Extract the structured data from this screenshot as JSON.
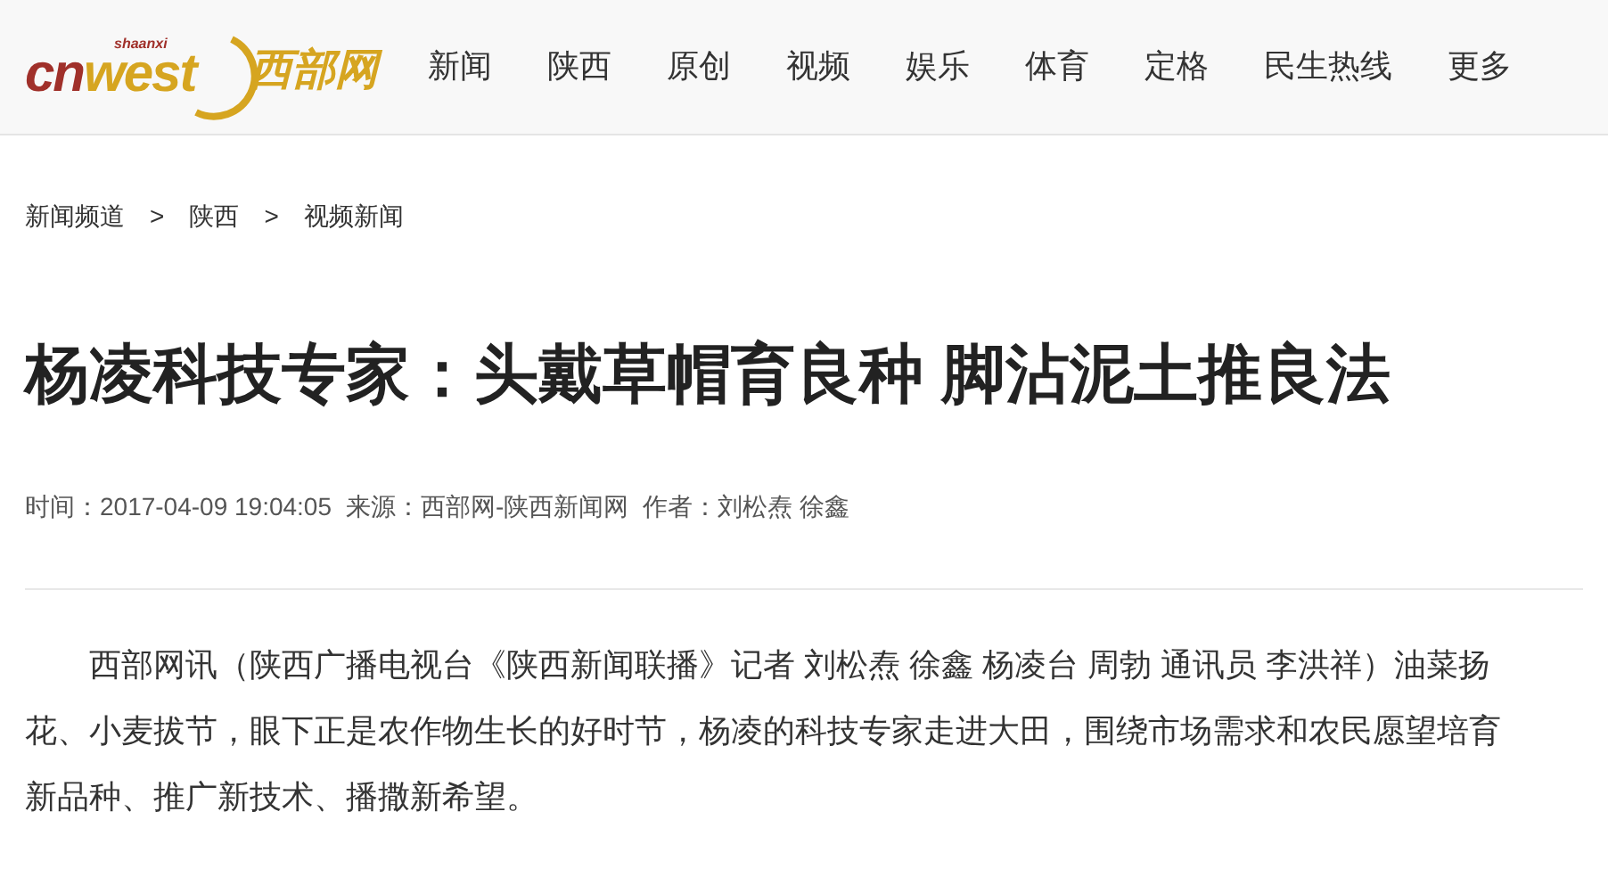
{
  "logo": {
    "wordmark": "cnwest",
    "tagline": "shaanxi",
    "name": "西部网"
  },
  "nav": [
    {
      "label": "新闻"
    },
    {
      "label": "陕西"
    },
    {
      "label": "原创"
    },
    {
      "label": "视频"
    },
    {
      "label": "娱乐"
    },
    {
      "label": "体育"
    },
    {
      "label": "定格"
    },
    {
      "label": "民生热线"
    },
    {
      "label": "更多"
    }
  ],
  "breadcrumb": [
    {
      "label": "新闻频道"
    },
    {
      "label": "陕西"
    },
    {
      "label": "视频新闻"
    }
  ],
  "breadcrumb_separator": ">",
  "article": {
    "title": "杨凌科技专家：头戴草帽育良种 脚沾泥土推良法",
    "meta": [
      {
        "label": "时间：",
        "value": "2017-04-09 19:04:05"
      },
      {
        "label": "来源：",
        "value": "西部网-陕西新闻网"
      },
      {
        "label": "作者：",
        "value": "刘松焘 徐鑫"
      }
    ],
    "paragraphs": [
      "西部网讯（陕西广播电视台《陕西新闻联播》记者 刘松焘 徐鑫 杨凌台 周勃 通讯员 李洪祥）油菜扬花、小麦拔节，眼下正是农作物生长的好时节，杨凌的科技专家走进大田，围绕市场需求和农民愿望培育新品种、推广新技术、播撒新希望。"
    ]
  }
}
